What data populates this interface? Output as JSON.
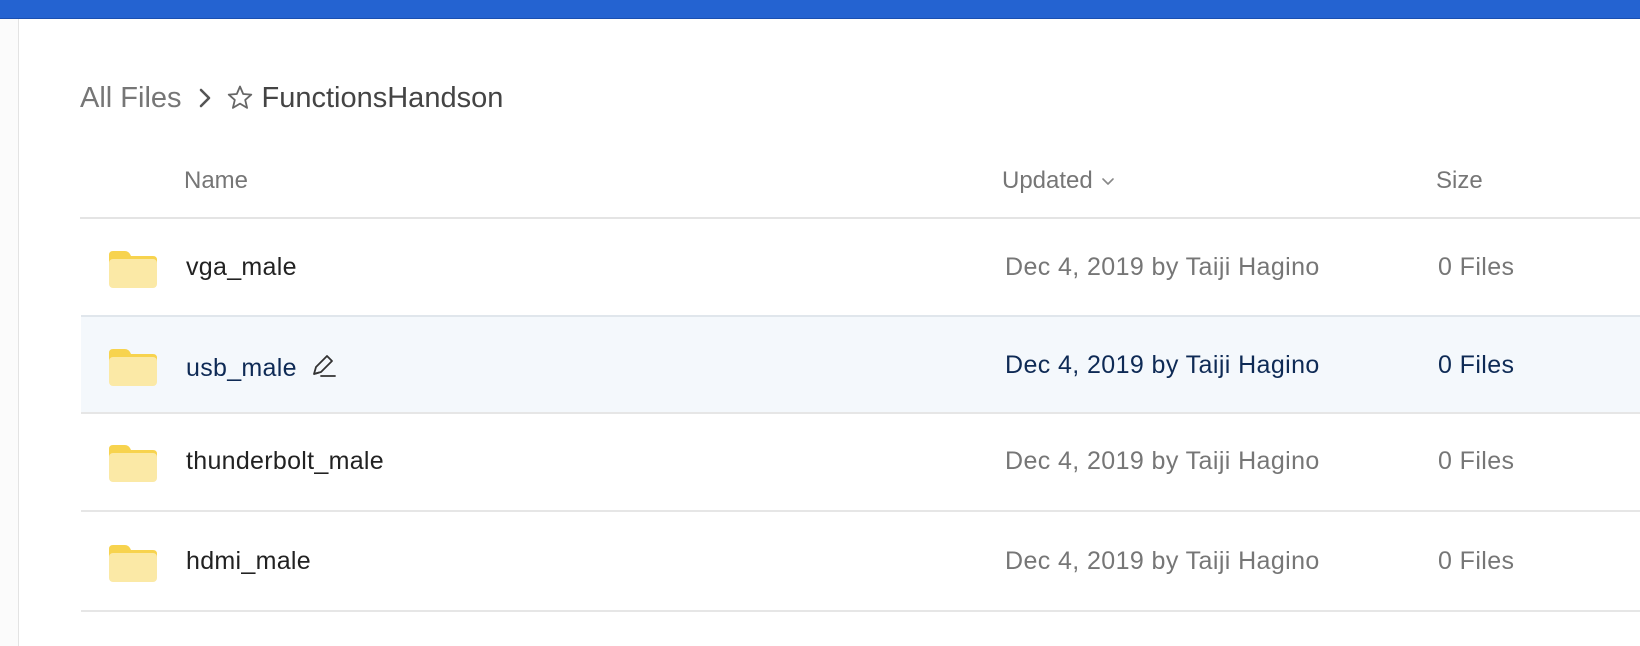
{
  "breadcrumb": {
    "root": "All Files",
    "current": "FunctionsHandson",
    "separator_icon": "chevron-right-icon",
    "favorite_icon": "star-outline-icon"
  },
  "table": {
    "columns": {
      "name": "Name",
      "updated": "Updated",
      "size": "Size"
    },
    "sort": {
      "column": "updated",
      "direction": "descending",
      "icon": "chevron-down-icon"
    },
    "rows": [
      {
        "name": "vga_male",
        "updated": "Dec 4, 2019 by Taiji Hagino",
        "size": "0 Files",
        "icon": "folder-icon"
      },
      {
        "name": "usb_male",
        "updated": "Dec 4, 2019 by Taiji Hagino",
        "size": "0 Files",
        "icon": "folder-icon",
        "hovered": true,
        "action_icon": "pencil-edit-icon"
      },
      {
        "name": "thunderbolt_male",
        "updated": "Dec 4, 2019 by Taiji Hagino",
        "size": "0 Files",
        "icon": "folder-icon"
      },
      {
        "name": "hdmi_male",
        "updated": "Dec 4, 2019 by Taiji Hagino",
        "size": "0 Files",
        "icon": "folder-icon"
      }
    ]
  },
  "colors": {
    "top_bar": "#2463d1",
    "hover_row": "#f4f8fc",
    "folder_body": "#fbe9a6",
    "folder_tab": "#f7d34e",
    "hover_text": "#0e2a55"
  }
}
